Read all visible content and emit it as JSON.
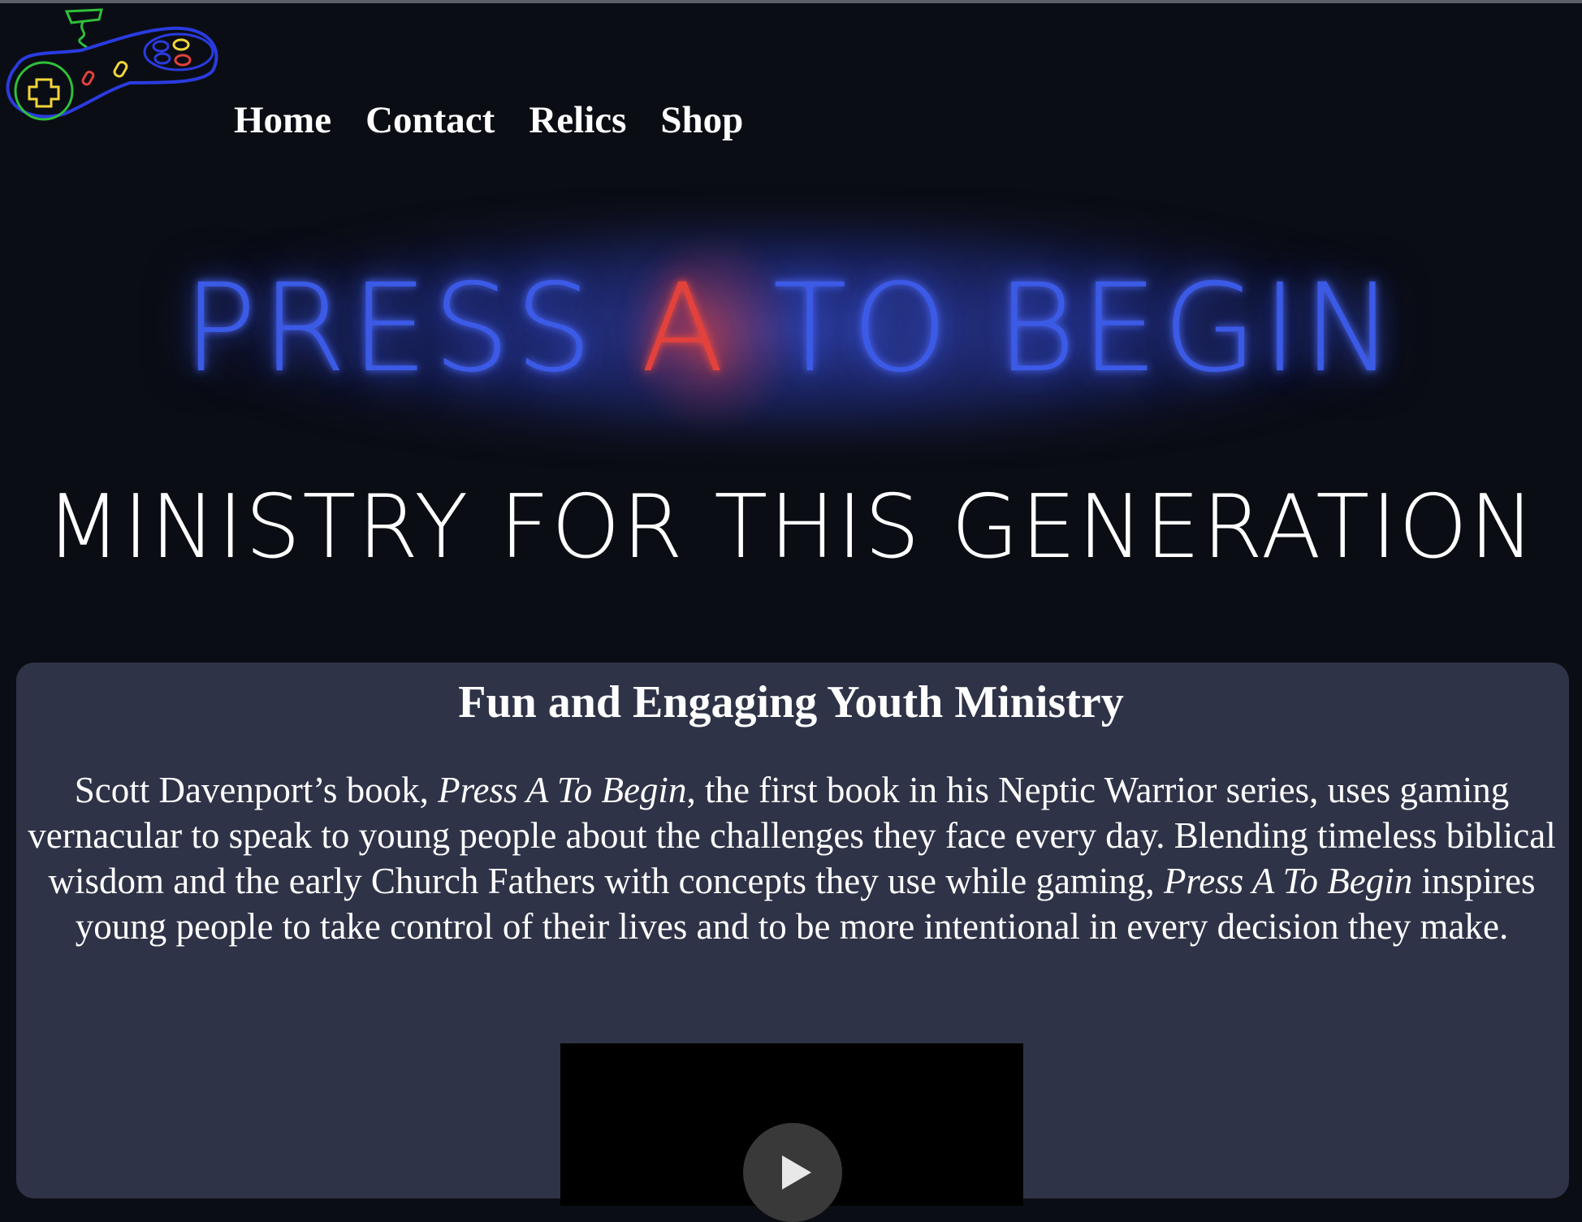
{
  "nav": {
    "items": [
      {
        "label": "Home"
      },
      {
        "label": "Contact"
      },
      {
        "label": "Relics"
      },
      {
        "label": "Shop"
      }
    ]
  },
  "hero": {
    "title_part1": "PRESS ",
    "title_highlight": "A",
    "title_part2": " TO BEGIN",
    "subtitle": "MINISTRY FOR THIS GENERATION"
  },
  "card": {
    "heading": "Fun and Engaging Youth Ministry",
    "body": {
      "p1": "Scott Davenport’s book, ",
      "book_title_1": "Press A To Begin",
      "p2": ", the first book in his Neptic Warrior series, uses gaming vernacular to speak to young people about the challenges they face every day. Blending timeless biblical wisdom and the early Church Fathers with concepts they use while gaming, ",
      "book_title_2": "Press A To Begin",
      "p3": " inspires young people to take control of their lives and to be more intentional in every decision they make."
    }
  },
  "video": {
    "play_icon": "play-icon"
  },
  "logo": {
    "icon": "game-controller-icon",
    "colors": {
      "body": "#2a3be0",
      "dpad": "#f0d63a",
      "dpad_ring": "#2fbf3a",
      "cable": "#2fbf3a",
      "button_red": "#e2413c",
      "button_yellow": "#f0d63a"
    }
  },
  "colors": {
    "background": "#0b0d14",
    "card": "#2f3347",
    "neon_blue": "#3b5ae6",
    "neon_red": "#e2413c"
  }
}
